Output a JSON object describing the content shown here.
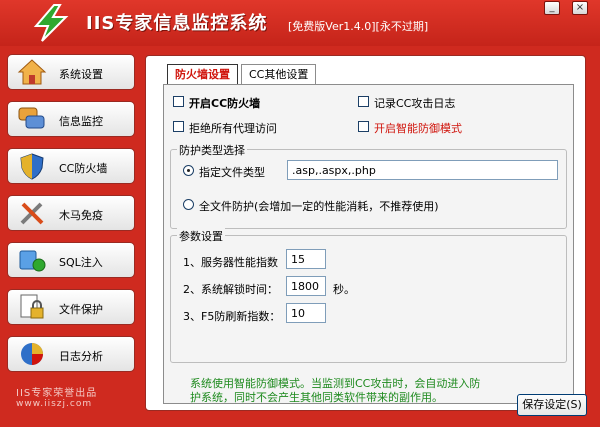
{
  "app": {
    "title": "IIS专家信息监控系统",
    "version": "[免费版Ver1.4.0][永不过期]",
    "window_buttons": [
      "_",
      "×"
    ]
  },
  "sidebar": {
    "items": [
      {
        "label": "系统设置",
        "icon": "home-icon"
      },
      {
        "label": "信息监控",
        "icon": "chat-bubbles-icon"
      },
      {
        "label": "CC防火墙",
        "icon": "shield-icon"
      },
      {
        "label": "木马免疫",
        "icon": "tools-icon"
      },
      {
        "label": "SQL注入",
        "icon": "database-icon"
      },
      {
        "label": "文件保护",
        "icon": "file-lock-icon"
      },
      {
        "label": "日志分析",
        "icon": "pie-chart-icon"
      }
    ],
    "brand": "IIS专家荣誉出品",
    "brand_url": "www.iiszj.com"
  },
  "tabs": [
    {
      "label": "防火墙设置",
      "active": true
    },
    {
      "label": "CC其他设置",
      "active": false
    }
  ],
  "options": {
    "enable_cc": "开启CC防火墙",
    "log_cc": "记录CC攻击日志",
    "deny_proxy": "拒绝所有代理访问",
    "smart_defense": "开启智能防御模式"
  },
  "protection": {
    "legend": "防护类型选择",
    "specified_label": "指定文件类型",
    "specified_value": ".asp,.aspx,.php",
    "all_label": "全文件防护(会增加一定的性能消耗，不推荐使用)"
  },
  "params": {
    "legend": "参数设置",
    "rows": [
      {
        "label": "1、服务器性能指数",
        "value": "15",
        "unit": ""
      },
      {
        "label": "2、系统解锁时间：",
        "value": "1800",
        "unit": "秒。"
      },
      {
        "label": "3、F5防刷新指数：",
        "value": "10",
        "unit": ""
      }
    ]
  },
  "note": "系统使用智能防御模式。当监测到CC攻击时，会自动进入防护系统，同时不会产生其他同类软件带来的副作用。",
  "save_button": "保存设定(S)",
  "colors": {
    "frame": "#cf2a1f",
    "note_green": "#1e8a1e",
    "warning_red": "#d0140c"
  }
}
